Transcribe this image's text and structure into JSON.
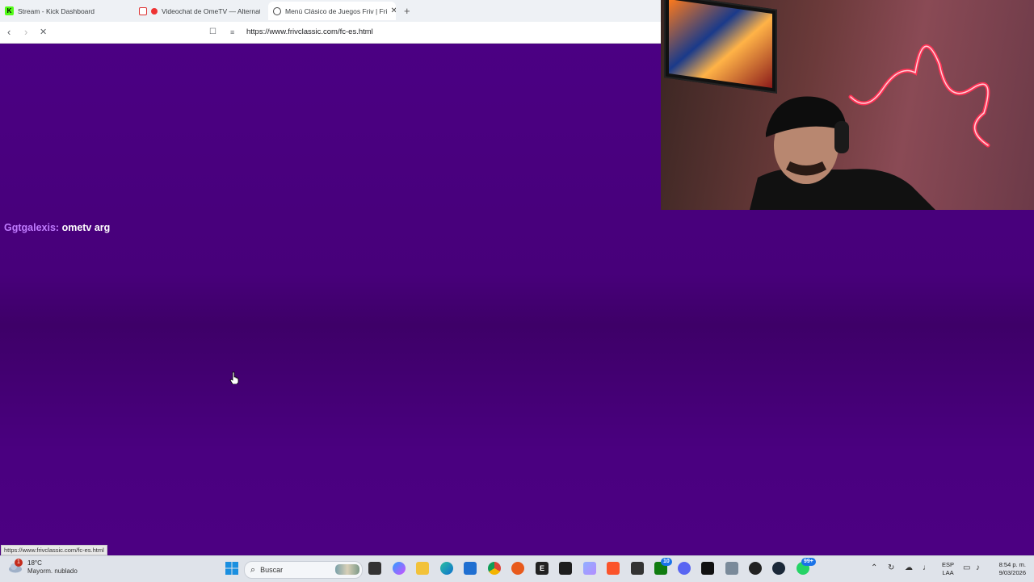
{
  "browser": {
    "tabs": [
      {
        "title": "Stream - Kick Dashboard",
        "icon": "kick-icon",
        "active": false
      },
      {
        "title": "Videochat de OmeTV — Alternat",
        "icon": "recording-icon",
        "active": false
      },
      {
        "title": "Menú Clásico de Juegos Friv | Fri",
        "icon": "friv-icon",
        "active": true
      }
    ],
    "new_tab_label": "+",
    "url": "https://www.frivclassic.com/fc-es.html"
  },
  "page": {
    "background": "#4b0083",
    "chat": {
      "user": "Ggtgalexis:",
      "message": "ometv arg"
    },
    "status_url": "https://www.frivclassic.com/fc-es.html"
  },
  "taskbar": {
    "weather": {
      "temp": "18°C",
      "condition": "Mayorm. nublado",
      "badge": "1"
    },
    "search_label": "Buscar",
    "apps": [
      "windows-start-icon",
      "file-explorer-icon",
      "copilot-icon",
      "folder-icon",
      "edge-icon",
      "store-icon",
      "chrome-icon",
      "brave-orange-icon",
      "epic-games-icon",
      "terminal-icon",
      "paint-icon",
      "brave-browser-icon",
      "app-icon",
      "xbox-icon",
      "discord-icon",
      "call-of-duty-icon",
      "camera-icon",
      "red-app-icon",
      "steam-icon",
      "whatsapp-icon"
    ],
    "xbox_badge": "10",
    "whatsapp_badge": "99+",
    "lang_line1": "ESP",
    "lang_line2": "LAA",
    "time": "8:54 p. m.",
    "date": "9/03/2026"
  }
}
